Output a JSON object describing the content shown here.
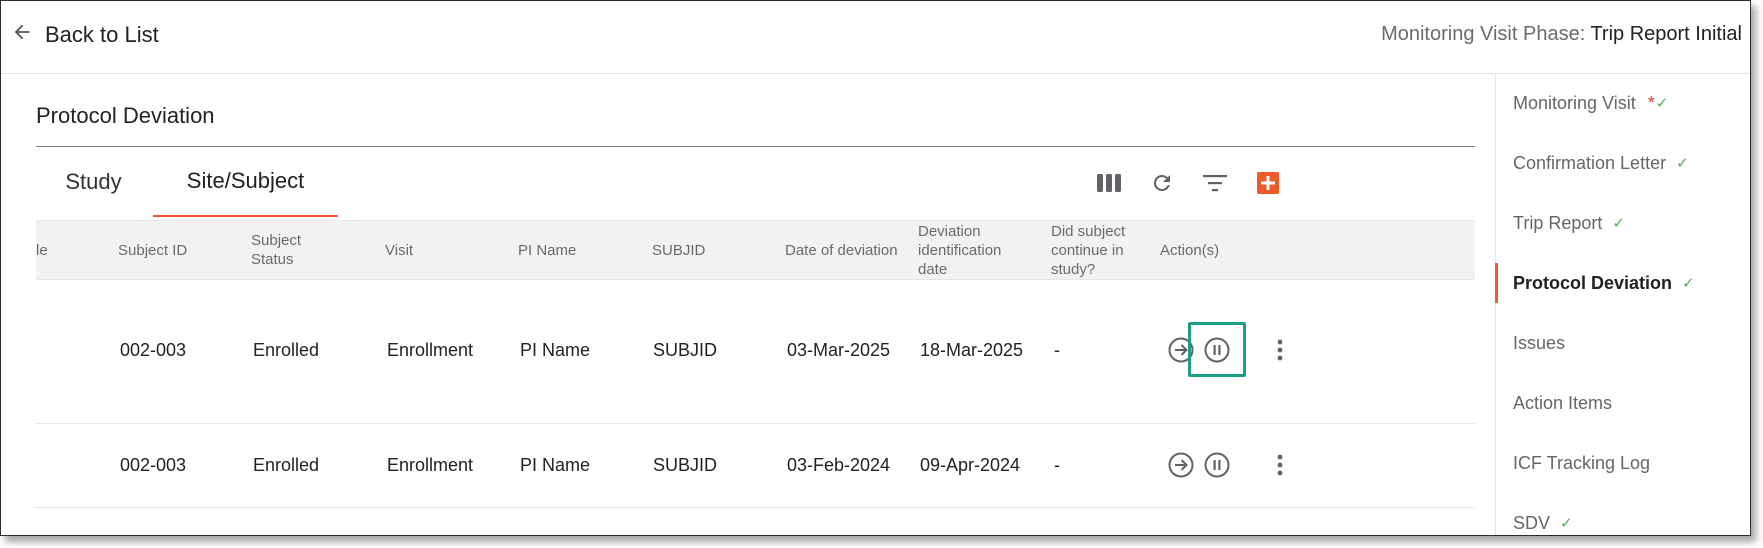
{
  "header": {
    "back_label": "Back to List",
    "phase_label": "Monitoring Visit Phase: ",
    "phase_value": "Trip Report Initial"
  },
  "section": {
    "title": "Protocol Deviation"
  },
  "tabs": [
    {
      "label": "Study",
      "active": false
    },
    {
      "label": "Site/Subject",
      "active": true
    }
  ],
  "toolbar": {
    "icons": [
      "columns-icon",
      "refresh-icon",
      "filter-icon",
      "add-icon"
    ],
    "accent_color": "#ef5a28"
  },
  "table": {
    "columns": [
      "le",
      "Subject ID",
      "Subject Status",
      "Visit",
      "PI Name",
      "SUBJID",
      "Date of deviation",
      "Deviation identification date",
      "Did subject continue in study?",
      "Action(s)"
    ],
    "rows": [
      {
        "cells": [
          "",
          "002-003",
          "Enrolled",
          "Enrollment",
          "PI Name",
          "SUBJID",
          "03-Mar-2025",
          "18-Mar-2025",
          "-"
        ],
        "highlighted_action": "pause"
      },
      {
        "cells": [
          "",
          "002-003",
          "Enrolled",
          "Enrollment",
          "PI Name",
          "SUBJID",
          "03-Feb-2024",
          "09-Apr-2024",
          "-"
        ],
        "highlighted_action": ""
      }
    ],
    "actions": [
      "arrow-right-circle-icon",
      "pause-circle-icon",
      "more-vertical-icon"
    ],
    "highlight_color": "#19a086"
  },
  "sidebar": {
    "items": [
      {
        "label": "Monitoring Visit",
        "required": "*",
        "check": "✓",
        "active": false
      },
      {
        "label": "Confirmation Letter",
        "required": "",
        "check": "✓",
        "active": false
      },
      {
        "label": "Trip Report",
        "required": "",
        "check": "✓",
        "active": false
      },
      {
        "label": "Protocol Deviation",
        "required": "",
        "check": "✓",
        "active": true
      },
      {
        "label": "Issues",
        "required": "",
        "check": "",
        "active": false
      },
      {
        "label": "Action Items",
        "required": "",
        "check": "",
        "active": false
      },
      {
        "label": "ICF Tracking Log",
        "required": "",
        "check": "",
        "active": false
      },
      {
        "label": "SDV",
        "required": "",
        "check": "✓",
        "active": false
      }
    ]
  }
}
